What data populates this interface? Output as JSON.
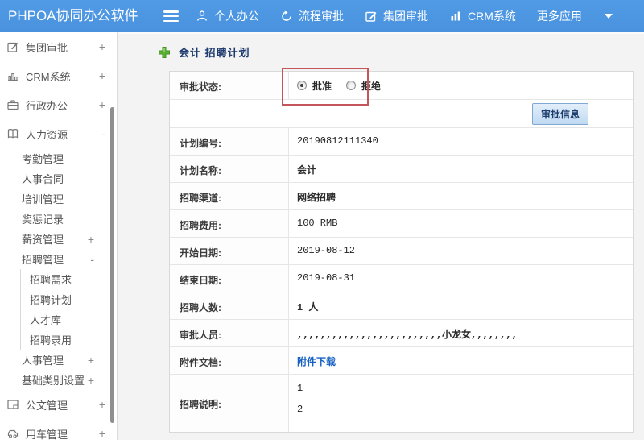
{
  "header": {
    "logo": "PHPOA协同办公软件",
    "nav": [
      {
        "label": "个人办公",
        "icon": "person-icon"
      },
      {
        "label": "流程审批",
        "icon": "history-icon"
      },
      {
        "label": "集团审批",
        "icon": "edit-icon"
      },
      {
        "label": "CRM系统",
        "icon": "bar-chart-icon"
      },
      {
        "label": "更多应用",
        "icon": "caret-down-icon"
      }
    ]
  },
  "sidebar": {
    "items": [
      {
        "label": "集团审批",
        "toggle": "+",
        "level": 1,
        "icon": "edit-icon"
      },
      {
        "label": "CRM系统",
        "toggle": "+",
        "level": 1,
        "icon": "bar-chart-icon"
      },
      {
        "label": "行政办公",
        "toggle": "+",
        "level": 1,
        "icon": "briefcase-icon"
      },
      {
        "label": "人力资源",
        "toggle": "-",
        "level": 1,
        "icon": "book-icon"
      },
      {
        "label": "考勤管理",
        "level": 2
      },
      {
        "label": "人事合同",
        "level": 2
      },
      {
        "label": "培训管理",
        "level": 2
      },
      {
        "label": "奖惩记录",
        "level": 2
      },
      {
        "label": "薪资管理",
        "toggle": "+",
        "level": 2
      },
      {
        "label": "招聘管理",
        "toggle": "-",
        "level": 2
      },
      {
        "label": "招聘需求",
        "level": 3
      },
      {
        "label": "招聘计划",
        "level": 3
      },
      {
        "label": "人才库",
        "level": 3
      },
      {
        "label": "招聘录用",
        "level": 3
      },
      {
        "label": "人事管理",
        "toggle": "+",
        "level": 2
      },
      {
        "label": "基础类别设置",
        "toggle": "+",
        "level": 2
      },
      {
        "label": "公文管理",
        "toggle": "+",
        "level": 1,
        "icon": "document-icon"
      },
      {
        "label": "用车管理",
        "toggle": "+",
        "level": 1,
        "icon": "car-icon"
      }
    ]
  },
  "main": {
    "title": "会计 招聘计划",
    "form": {
      "status_label": "审批状态:",
      "status_options": [
        {
          "label": "批准",
          "selected": true
        },
        {
          "label": "拒绝",
          "selected": false
        }
      ],
      "approval_info_button": "审批信息",
      "rows": [
        {
          "label": "计划编号:",
          "value": "20190812111340"
        },
        {
          "label": "计划名称:",
          "value": "会计"
        },
        {
          "label": "招聘渠道:",
          "value": "网络招聘"
        },
        {
          "label": "招聘费用:",
          "value": "100 RMB"
        },
        {
          "label": "开始日期:",
          "value": "2019-08-12"
        },
        {
          "label": "结束日期:",
          "value": "2019-08-31"
        },
        {
          "label": "招聘人数:",
          "value": "1 人"
        },
        {
          "label": "审批人员:",
          "value": ",,,,,,,,,,,,,,,,,,,,,,,,,小龙女,,,,,,,,"
        },
        {
          "label": "附件文档:",
          "value": "附件下载"
        },
        {
          "label": "招聘说明:",
          "lines": [
            "1",
            "2"
          ]
        }
      ]
    }
  },
  "colors": {
    "header_blue": "#4e96e2",
    "annotation_red": "#c4555c",
    "link_blue": "#1761c4",
    "title_navy": "#1e3a6e",
    "plus_green": "#5cb233"
  }
}
